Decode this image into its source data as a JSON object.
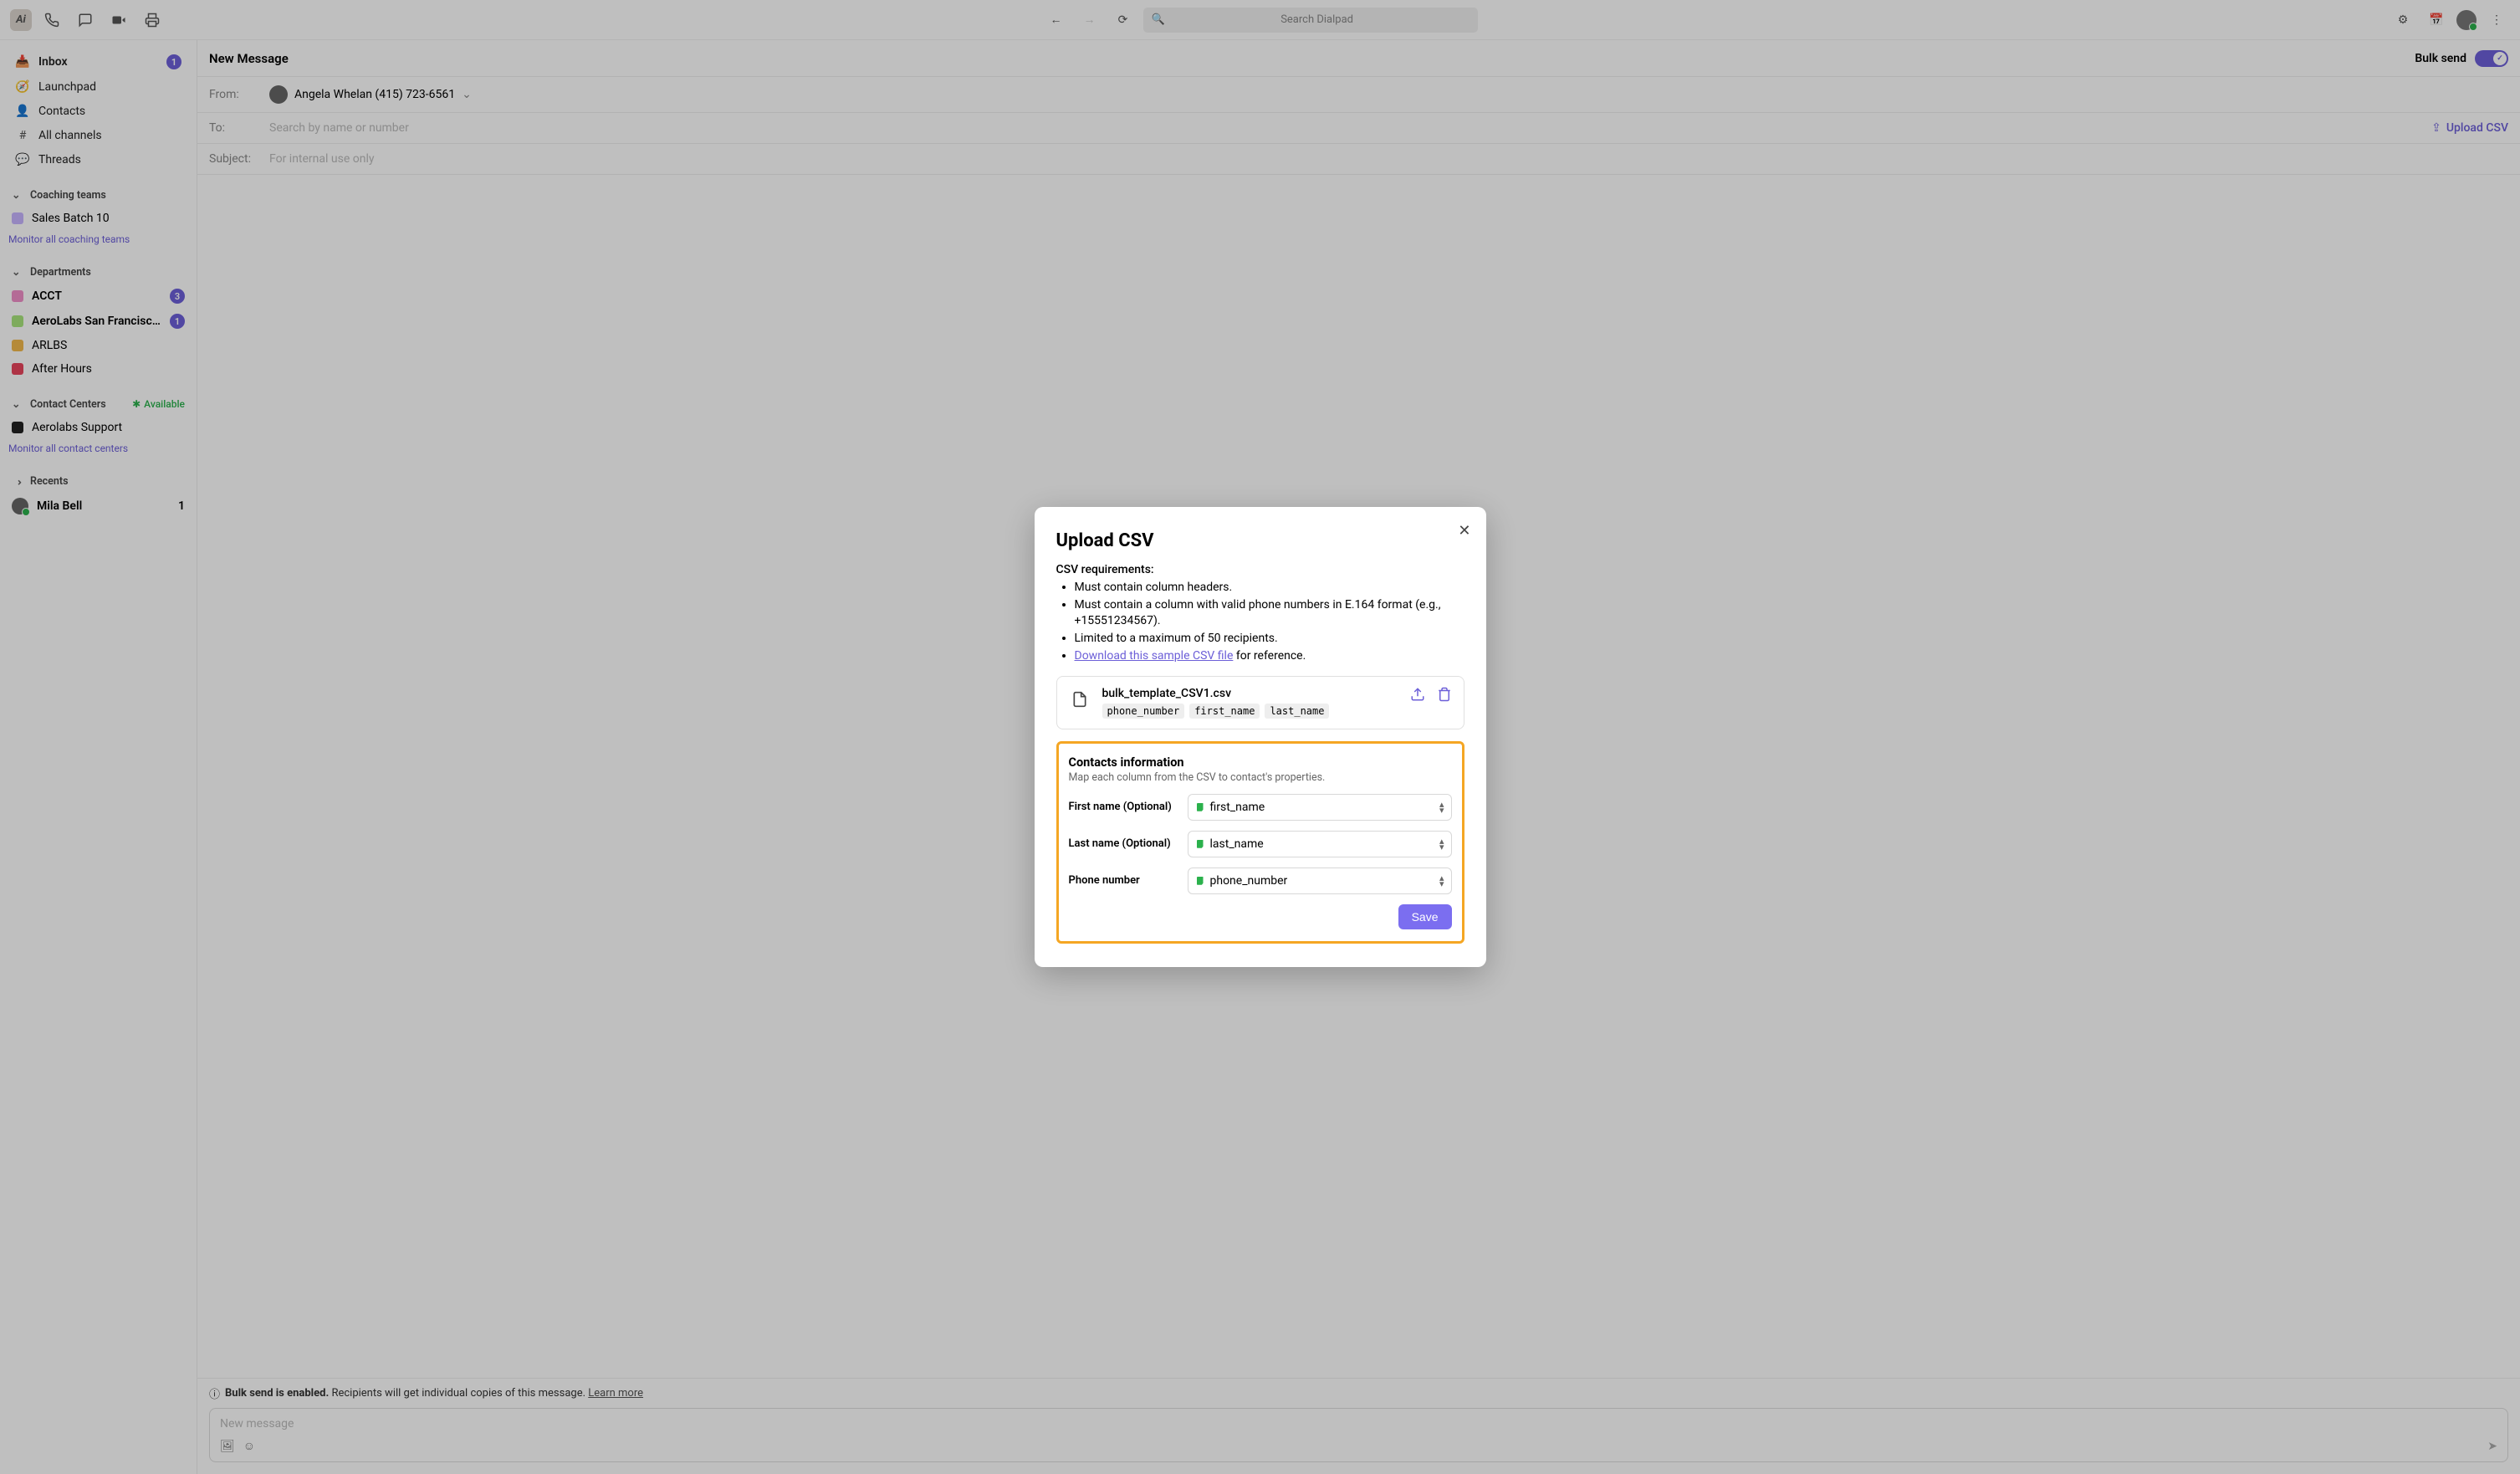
{
  "topbar": {
    "search_placeholder": "Search Dialpad"
  },
  "sidebar": {
    "nav": {
      "inbox": {
        "label": "Inbox",
        "badge": "1"
      },
      "launchpad": {
        "label": "Launchpad"
      },
      "contacts": {
        "label": "Contacts"
      },
      "all_channels": {
        "label": "All channels"
      },
      "threads": {
        "label": "Threads"
      }
    },
    "coaching": {
      "header": "Coaching teams",
      "items": [
        {
          "label": "Sales Batch 10",
          "color": "#c7b5ff"
        }
      ],
      "monitor": "Monitor all coaching teams"
    },
    "departments": {
      "header": "Departments",
      "items": [
        {
          "label": "ACCT",
          "badge": "3",
          "color": "#f08fc9",
          "bold": true
        },
        {
          "label": "AeroLabs San Francisc…",
          "badge": "1",
          "color": "#a9e57c",
          "bold": true
        },
        {
          "label": "ARLBS",
          "color": "#f2b84b"
        },
        {
          "label": "After Hours",
          "color": "#e8455d"
        }
      ]
    },
    "contact_centers": {
      "header": "Contact Centers",
      "status": "Available",
      "items": [
        {
          "label": "Aerolabs Support",
          "color": "#222"
        }
      ],
      "monitor": "Monitor all contact centers"
    },
    "recents": {
      "header": "Recents",
      "items": [
        {
          "label": "Mila Bell",
          "badge": "1"
        }
      ]
    }
  },
  "compose": {
    "title": "New Message",
    "bulk_send_label": "Bulk send",
    "from_label": "From:",
    "from_value": "Angela Whelan (415) 723-6561",
    "to_label": "To:",
    "to_placeholder": "Search by name or number",
    "upload_csv_label": "Upload CSV",
    "subject_label": "Subject:",
    "subject_placeholder": "For internal use only",
    "bulk_note_strong": "Bulk send is enabled.",
    "bulk_note_rest": " Recipients will get individual copies of this message. ",
    "learn_more": "Learn more",
    "input_placeholder": "New message"
  },
  "modal": {
    "title": "Upload CSV",
    "req_label": "CSV requirements:",
    "req1": "Must contain column headers.",
    "req2": "Must contain a column with valid phone numbers in E.164 format (e.g., +15551234567).",
    "req3": "Limited to a maximum of 50 recipients.",
    "req4_link": "Download this sample CSV file",
    "req4_rest": " for reference.",
    "file_name": "bulk_template_CSV1.csv",
    "file_tags": {
      "t1": "phone_number",
      "t2": "first_name",
      "t3": "last_name"
    },
    "contacts_title": "Contacts information",
    "contacts_sub": "Map each column from the CSV to contact's properties.",
    "first_name_label": "First name (Optional)",
    "first_name_value": "first_name",
    "last_name_label": "Last name (Optional)",
    "last_name_value": "last_name",
    "phone_label": "Phone number",
    "phone_value": "phone_number",
    "save_label": "Save"
  }
}
